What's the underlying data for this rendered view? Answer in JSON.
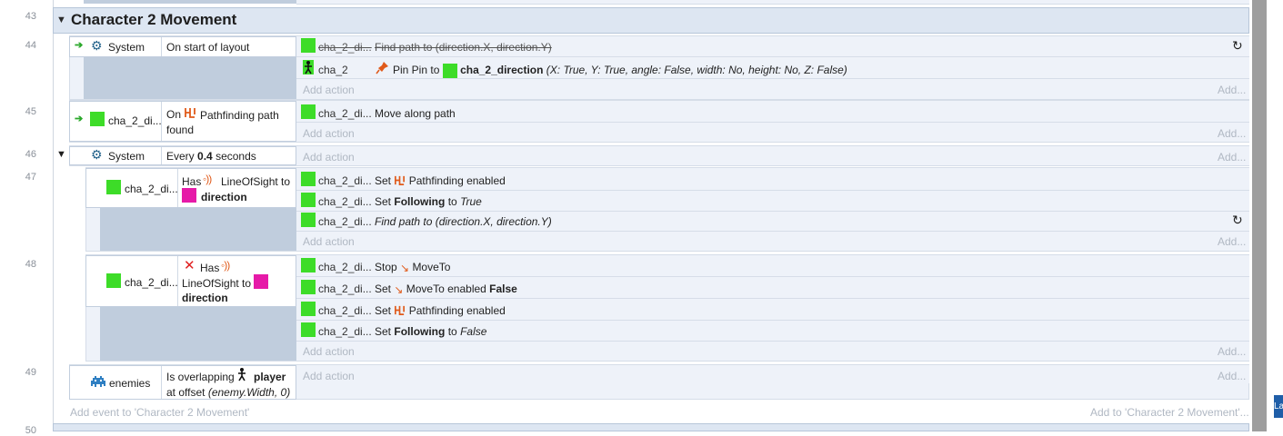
{
  "group": {
    "title": "Character 2 Movement",
    "add_event": "Add event to 'Character 2 Movement'",
    "add_to": "Add to 'Character 2 Movement'..."
  },
  "line_numbers": [
    "43",
    "44",
    "45",
    "46",
    "47",
    "48",
    "49",
    "50"
  ],
  "labels": {
    "add_action": "Add action",
    "add": "Add..."
  },
  "events": {
    "e44": {
      "cond_obj": "System",
      "cond_text": "On start of layout",
      "a1_obj": "cha_2_di...",
      "a1_text": "Find path to (direction.X, direction.Y)",
      "a2_obj": "cha_2",
      "a2_pre": "Pin Pin to",
      "a2_target": "cha_2_direction",
      "a2_params": "(X: True, Y: True, angle: False, width: No, height: No, Z: False)"
    },
    "e45": {
      "cond_obj": "cha_2_di...",
      "cond_on": "On",
      "cond_rest": "Pathfinding path found",
      "a1_obj": "cha_2_di...",
      "a1_text": "Move along path"
    },
    "e46": {
      "cond_obj": "System",
      "cond_pre": "Every",
      "cond_num": "0.4",
      "cond_post": "seconds"
    },
    "e47": {
      "cond_obj": "cha_2_di...",
      "cond_has": "Has",
      "cond_behavior": "LineOfSight to",
      "cond_target": "direction",
      "a1_obj": "cha_2_di...",
      "a1_set": "Set",
      "a1_beh": "Pathfinding enabled",
      "a2_obj": "cha_2_di...",
      "a2_set": "Set",
      "a2_prop": "Following",
      "a2_to": "to",
      "a2_val": "True",
      "a3_obj": "cha_2_di...",
      "a3_text": "Find path to (direction.X, direction.Y)"
    },
    "e48": {
      "cond_obj": "cha_2_di...",
      "cond_has": "Has",
      "cond_behavior": "LineOfSight to",
      "cond_target": "direction",
      "a1_obj": "cha_2_di...",
      "a1_pre": "Stop",
      "a1_beh": "MoveTo",
      "a2_obj": "cha_2_di...",
      "a2_set": "Set",
      "a2_beh": "MoveTo enabled",
      "a2_val": "False",
      "a3_obj": "cha_2_di...",
      "a3_set": "Set",
      "a3_beh": "Pathfinding enabled",
      "a4_obj": "cha_2_di...",
      "a4_set": "Set",
      "a4_prop": "Following",
      "a4_to": "to",
      "a4_val": "False"
    },
    "e49": {
      "cond_obj": "enemies",
      "cond_pre": "Is overlapping",
      "cond_target": "player",
      "cond_offset_pre": "at offset",
      "cond_offset": "(enemy.Width, 0)"
    }
  },
  "corner_label": "La",
  "colors": {
    "object_green": "#3ddc28",
    "object_pink": "#e61aa8",
    "behavior_orange": "#e05a1a",
    "group_header": "#dde6f2"
  },
  "icons": [
    "gear-icon",
    "pin-icon",
    "pathfinding-icon",
    "line-of-sight-icon",
    "moveto-icon",
    "invert-x-icon",
    "refresh-icon",
    "person-icon",
    "enemy-icon",
    "trigger-arrow-icon"
  ]
}
